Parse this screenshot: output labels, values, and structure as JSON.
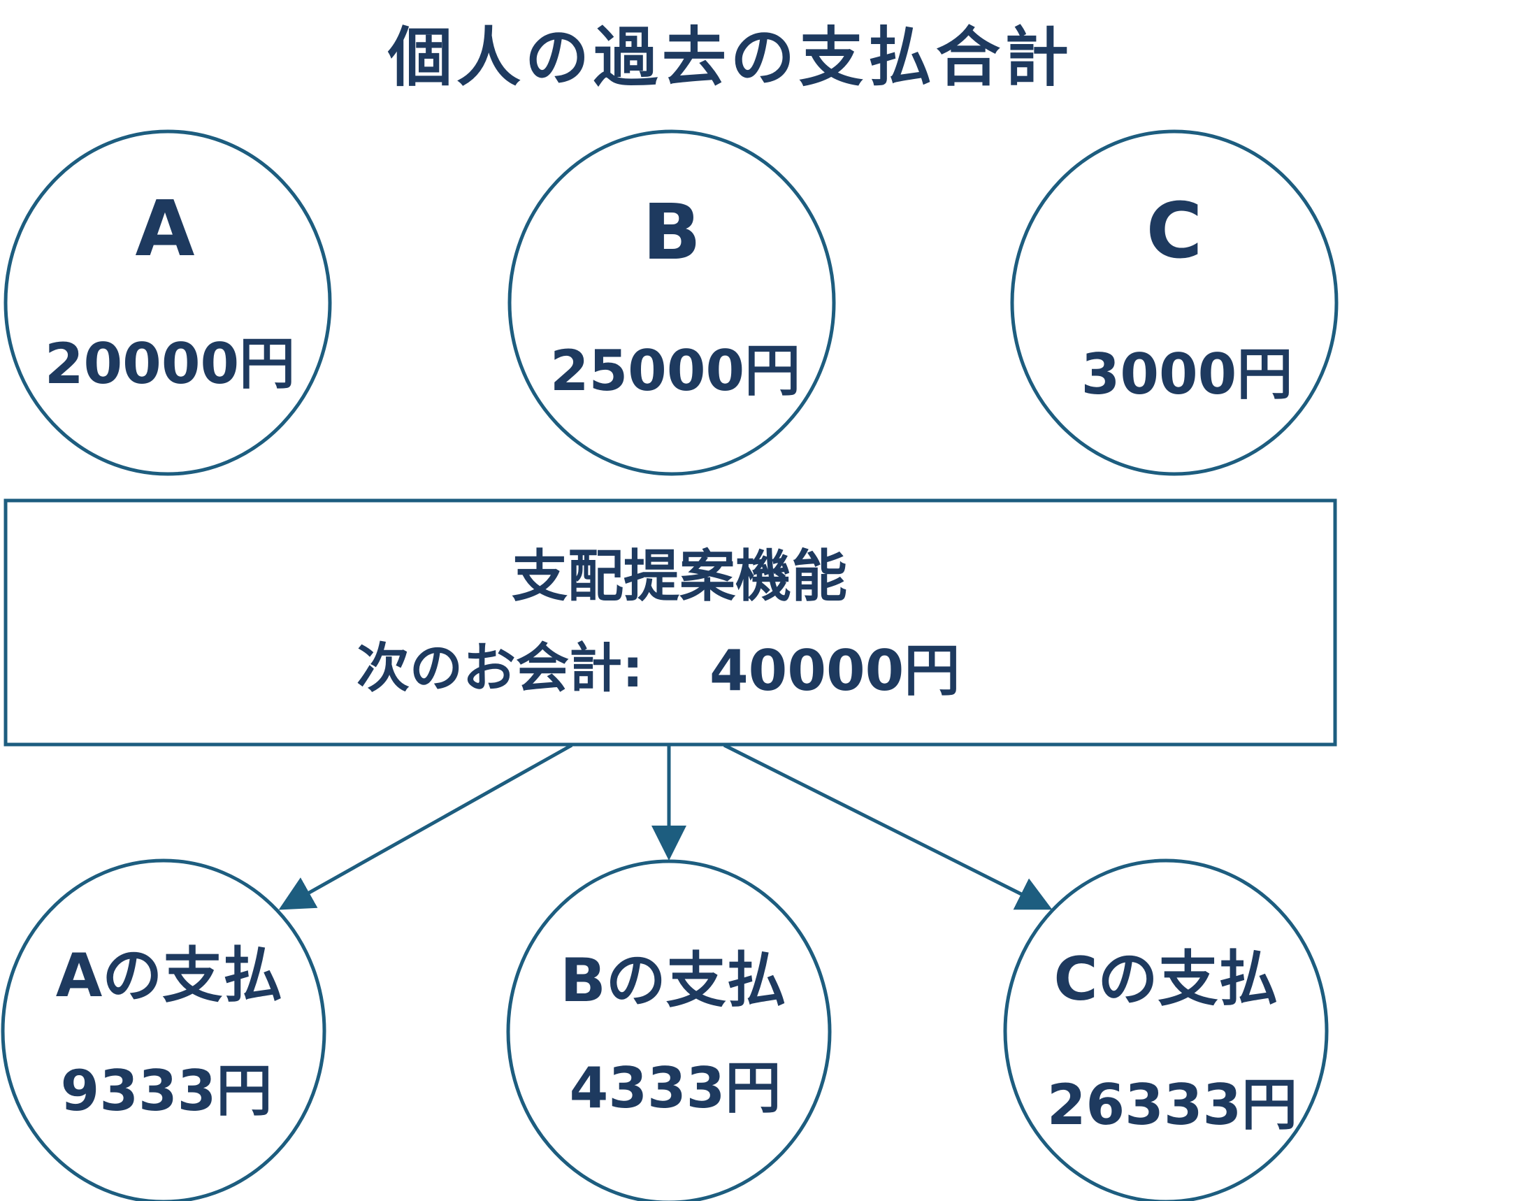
{
  "title": "個人の過去の支払合計",
  "colors": {
    "stroke": "#1d5d7f",
    "text": "#1e3a5f",
    "background": "#ffffff"
  },
  "past_payments": [
    {
      "name": "A",
      "amount": "20000円"
    },
    {
      "name": "B",
      "amount": "25000円"
    },
    {
      "name": "C",
      "amount": "3000円"
    }
  ],
  "proposal": {
    "title": "支配提案機能",
    "next_bill_label": "次のお会計:",
    "next_bill_amount": "40000円"
  },
  "split_payments": [
    {
      "label": "Aの支払",
      "amount": "9333円"
    },
    {
      "label": "Bの支払",
      "amount": "4333円"
    },
    {
      "label": "Cの支払",
      "amount": "26333円"
    }
  ]
}
